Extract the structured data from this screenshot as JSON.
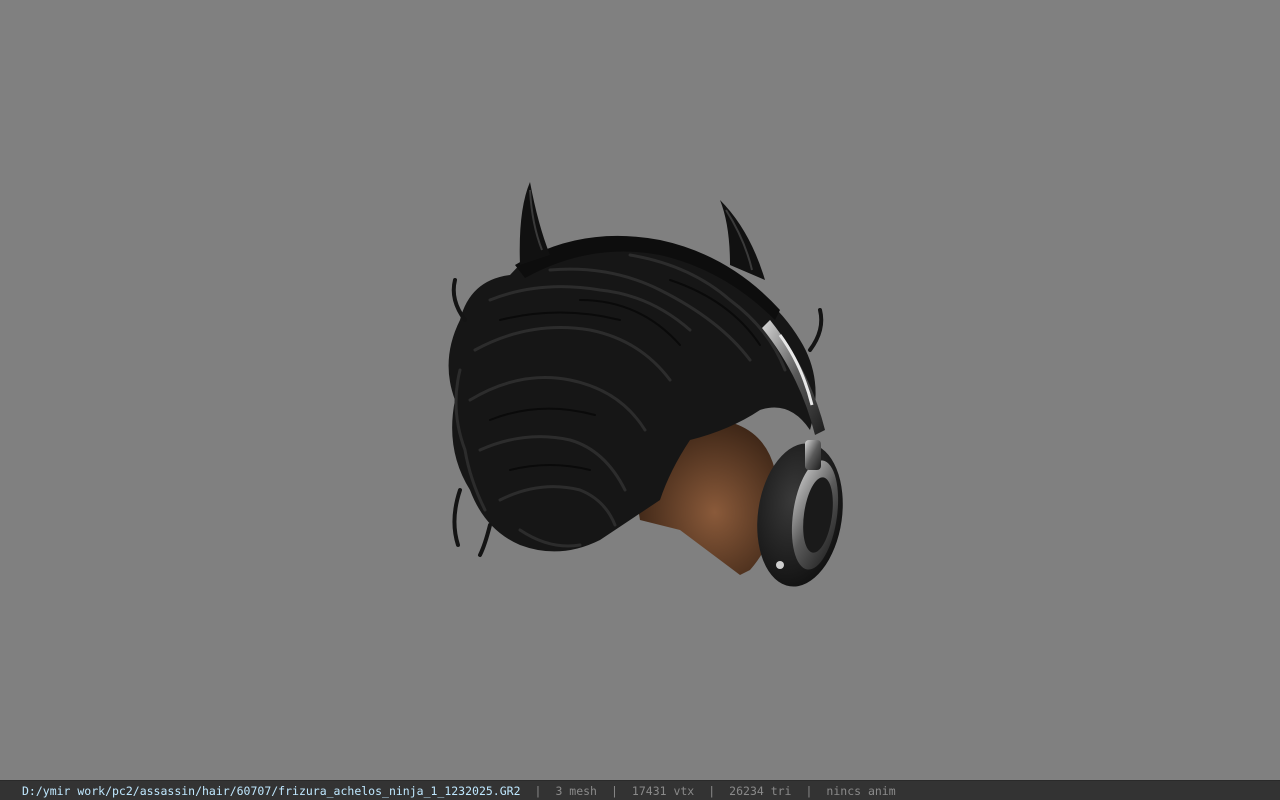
{
  "viewer": {
    "background_color": "#808080",
    "model_icon": "hair-model-icon"
  },
  "statusbar": {
    "file_path": "D:/ymir work/pc2/assassin/hair/60707/frizura_achelos_ninja_1_1232025.GR2",
    "separator": "|",
    "mesh_count": "3 mesh",
    "vertex_count": "17431 vtx",
    "triangle_count": "26234 tri",
    "animation_status": "nincs anim",
    "path_color": "#bfe8ff",
    "text_color": "#8a8a8a"
  }
}
